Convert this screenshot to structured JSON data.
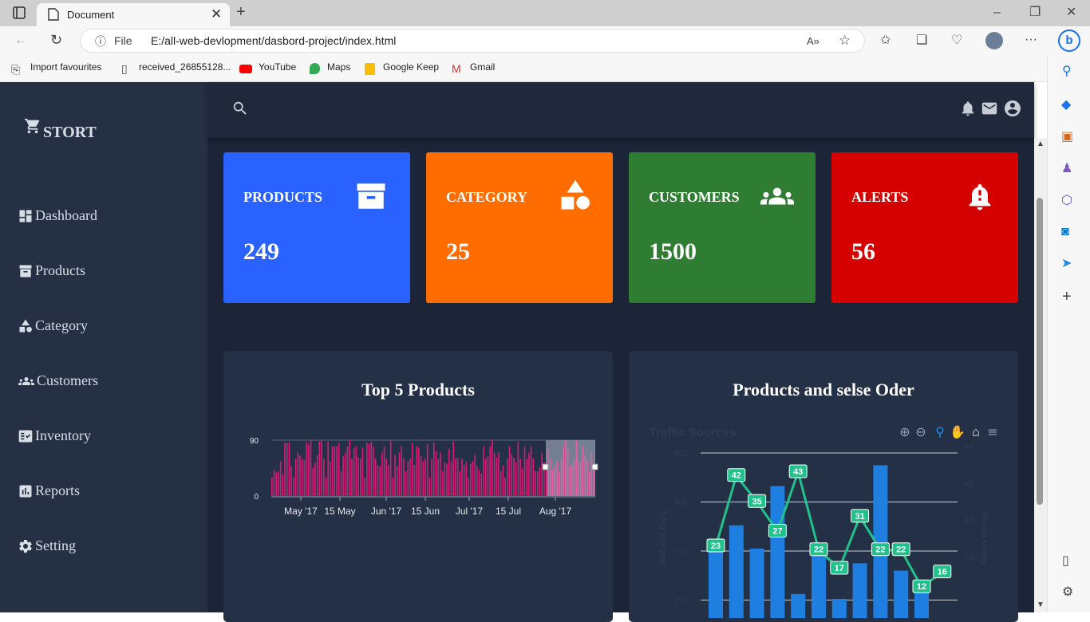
{
  "browser": {
    "tab_title": "Document",
    "address_label": "File",
    "url": "E:/all-web-devlopment/dasbord-project/index.html",
    "favourites": [
      "Import favourites",
      "received_26855128...",
      "YouTube",
      "Maps",
      "Google Keep",
      "Gmail"
    ]
  },
  "sidebar": {
    "brand": "STORT",
    "items": [
      {
        "label": "Dashboard",
        "icon": "dashboard-icon"
      },
      {
        "label": "Products",
        "icon": "archive-icon"
      },
      {
        "label": "Category",
        "icon": "shapes-icon"
      },
      {
        "label": "Customers",
        "icon": "people-icon"
      },
      {
        "label": "Inventory",
        "icon": "fact-check-icon"
      },
      {
        "label": "Reports",
        "icon": "bar-chart-icon"
      },
      {
        "label": "Setting",
        "icon": "gear-icon"
      }
    ]
  },
  "cards": [
    {
      "title": "PRODUCTS",
      "value": "249",
      "color": "#2962ff",
      "icon": "archive-icon"
    },
    {
      "title": "CATEGORY",
      "value": "25",
      "color": "#ff6d00",
      "icon": "shapes-icon"
    },
    {
      "title": "CUSTOMERS",
      "value": "1500",
      "color": "#2e7d32",
      "icon": "people-icon"
    },
    {
      "title": "ALERTS",
      "value": "56",
      "color": "#d50000",
      "icon": "bell-icon"
    }
  ],
  "panels": {
    "left_title": "Top 5 Products",
    "right_title": "Products and selse Oder"
  },
  "chart_data": [
    {
      "type": "bar",
      "title": "Top 5 Products",
      "ytick_labels": [
        "90",
        "0"
      ],
      "xtick_labels": [
        "May '17",
        "15 May",
        "Jun '17",
        "15 Jun",
        "Jul '17",
        "15 Jul",
        "Aug '17"
      ],
      "ylim": [
        0,
        90
      ],
      "values": [
        30,
        42,
        38,
        40,
        56,
        35,
        86,
        86,
        86,
        48,
        30,
        60,
        70,
        66,
        60,
        58,
        87,
        83,
        90,
        46,
        54,
        66,
        88,
        89,
        60,
        30,
        88,
        56,
        80,
        80,
        80,
        85,
        40,
        64,
        70,
        80,
        90,
        60,
        77,
        80,
        62,
        60,
        78,
        30,
        86,
        84,
        88,
        80,
        60,
        50,
        48,
        70,
        80,
        60,
        50,
        90,
        30,
        66,
        48,
        70,
        80,
        60,
        40,
        56,
        60,
        86,
        50,
        80,
        78,
        64,
        56,
        60,
        84,
        30,
        60,
        86,
        72,
        60,
        70,
        40,
        54,
        52,
        76,
        56,
        88,
        60,
        62,
        40,
        60,
        50,
        55,
        30,
        52,
        56,
        66,
        48,
        42,
        36,
        80,
        60,
        64,
        80,
        90,
        70,
        62,
        70,
        40,
        50,
        30,
        60,
        80,
        68,
        62,
        54,
        88,
        60,
        44,
        80,
        60,
        70,
        80,
        60,
        40,
        40,
        46,
        70,
        54,
        50,
        76,
        60,
        42,
        50,
        56,
        38,
        60,
        80,
        90,
        76,
        48,
        50,
        60,
        90,
        56,
        54,
        80,
        66,
        58,
        40,
        70,
        48
      ],
      "selection_range": [
        "Aug '17",
        "end"
      ]
    },
    {
      "type": "bar+line",
      "title": "Traffic Sources",
      "ylabel": "Website Blog",
      "y2label": "Social Media",
      "yticks": [
        "800",
        "600",
        "400",
        "200"
      ],
      "y2ticks": [
        "50",
        "40",
        "30",
        "20"
      ],
      "series": [
        {
          "name": "Website Blog",
          "values": [
            440,
            505,
            410,
            665,
            225,
            410,
            205,
            350,
            750,
            320,
            250
          ]
        },
        {
          "name": "Social Media",
          "values": [
            23,
            42,
            35,
            27,
            43,
            22,
            17,
            31,
            22,
            22,
            12,
            16
          ]
        }
      ],
      "toolbar": [
        "zoom-in-icon",
        "zoom-out-icon",
        "selection-zoom-icon",
        "pan-icon",
        "home-icon",
        "menu-icon"
      ]
    }
  ]
}
